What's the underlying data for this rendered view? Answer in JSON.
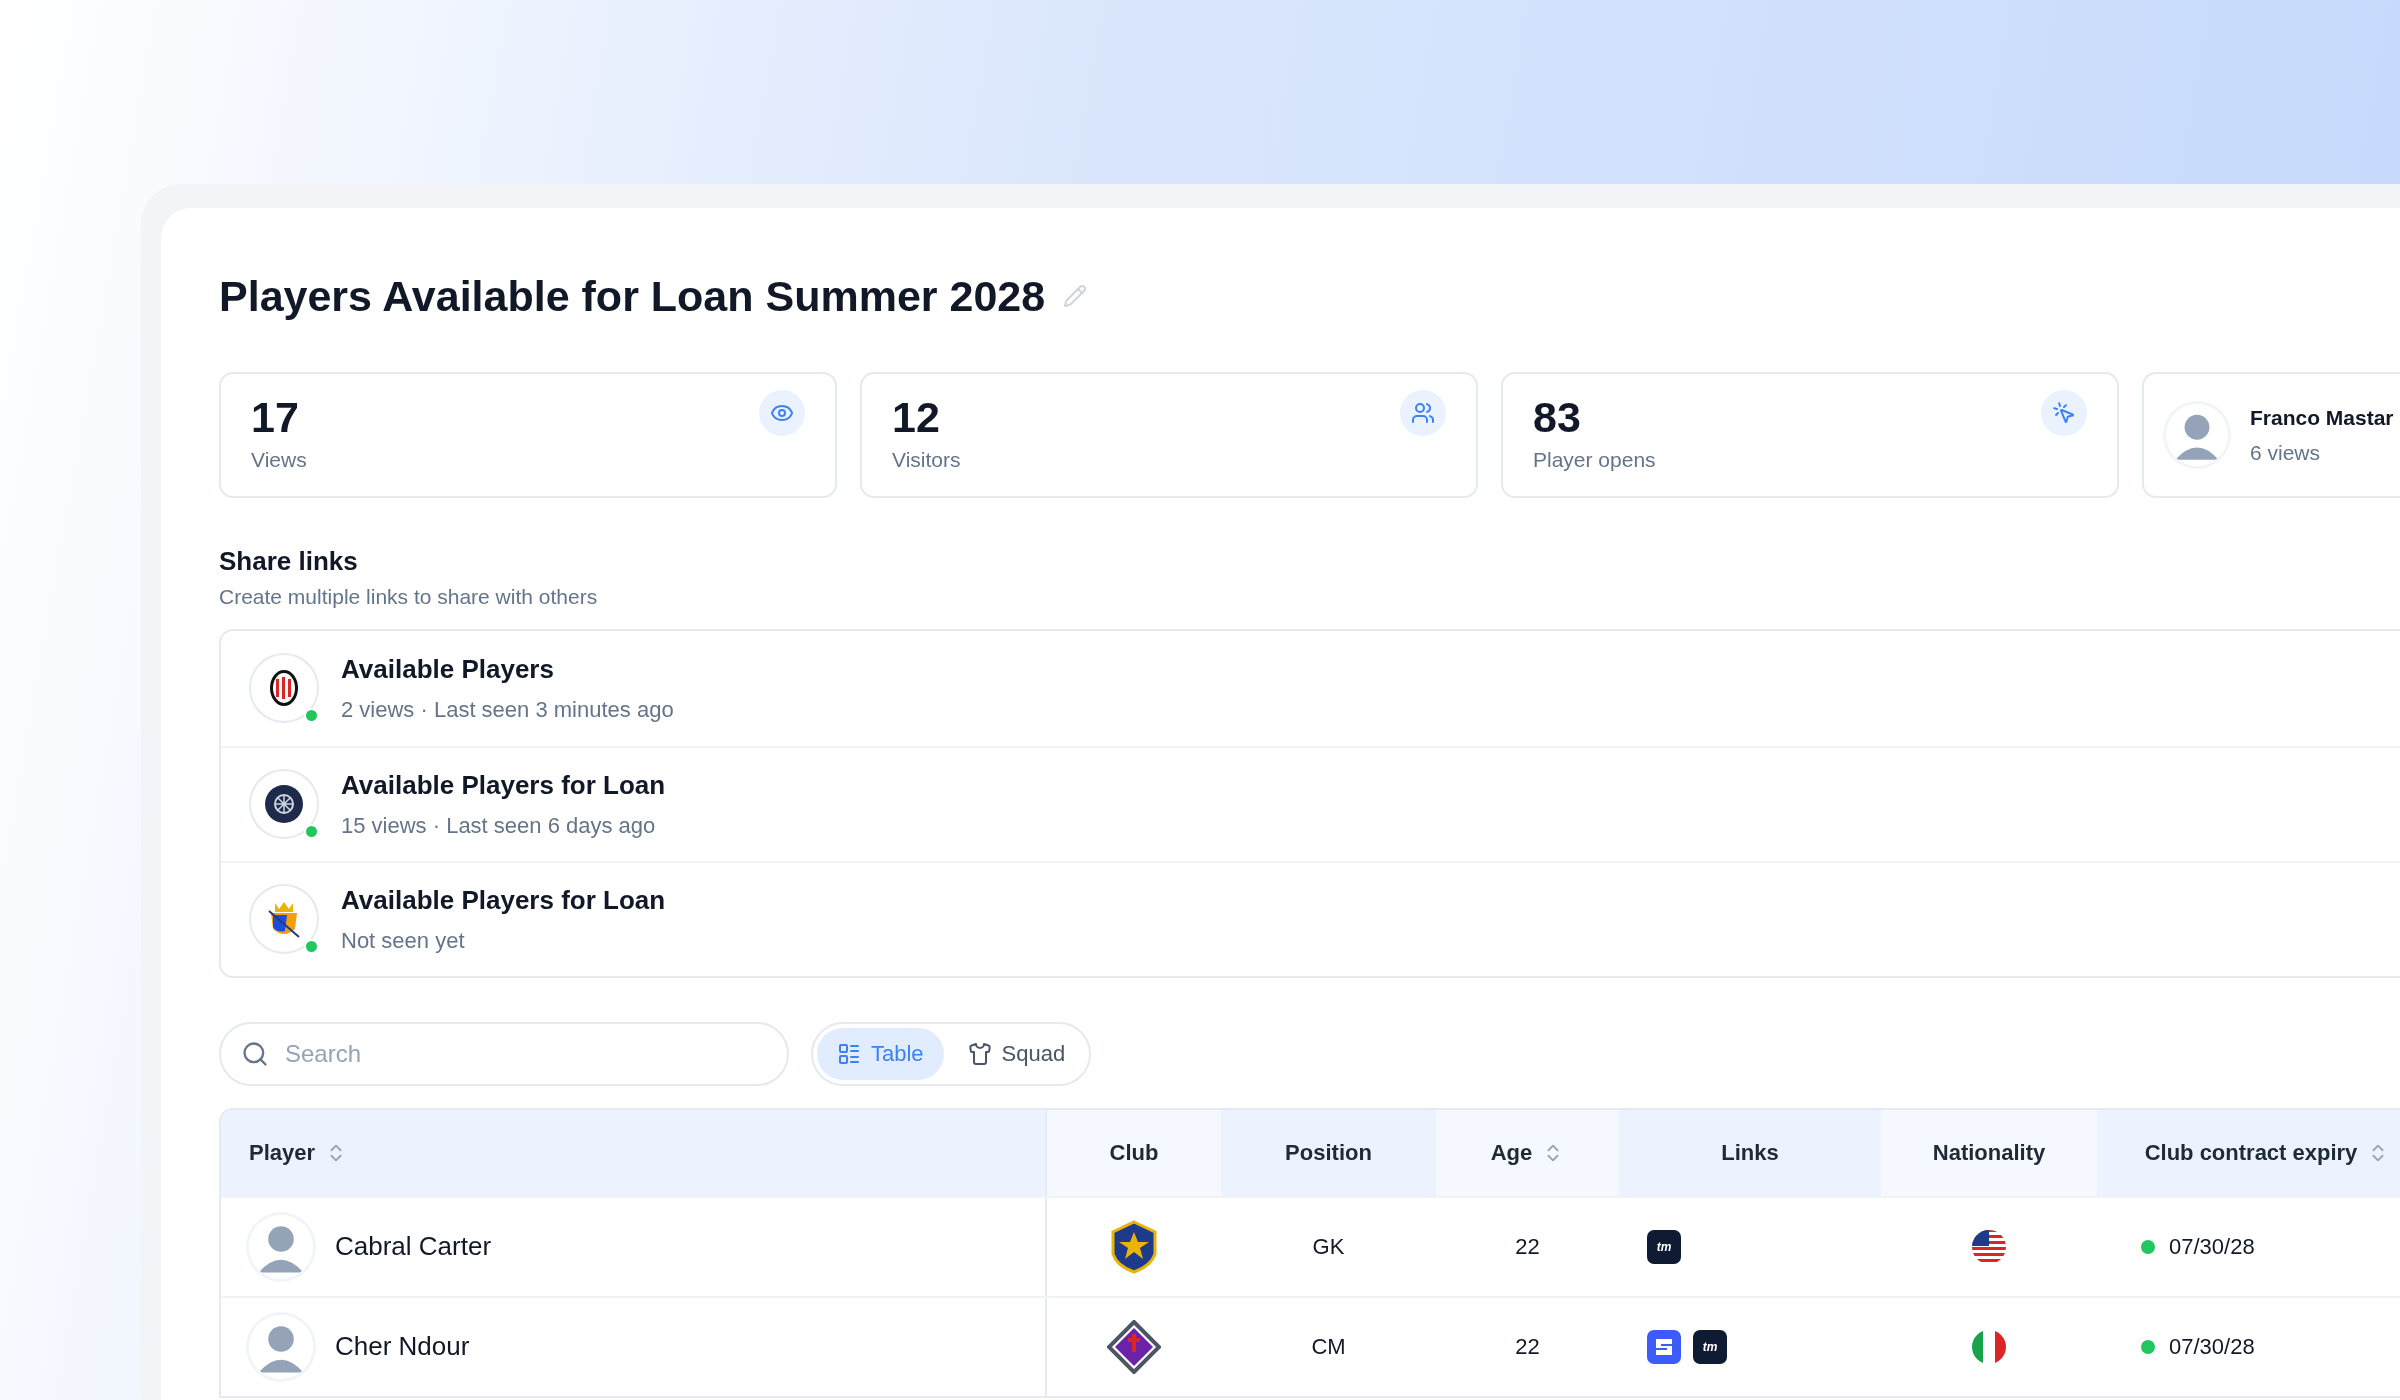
{
  "title": "Players Available for Loan Summer 2028",
  "stats": [
    {
      "kind": "views",
      "value": "17",
      "label": "Views"
    },
    {
      "kind": "visitors",
      "value": "12",
      "label": "Visitors"
    },
    {
      "kind": "opens",
      "value": "83",
      "label": "Player opens"
    }
  ],
  "top_viewer": {
    "name": "Franco Mastar",
    "views": "6 views"
  },
  "share_links": {
    "title": "Share links",
    "subtitle": "Create multiple links to share with others",
    "items": [
      {
        "crest": {
          "kind": "stripes"
        },
        "title": "Available Players",
        "meta": "2 views · Last seen 3 minutes ago",
        "color": "#22c55e"
      },
      {
        "crest": {
          "kind": "navy"
        },
        "title": "Available Players for Loan",
        "meta": "15 views · Last seen 6 days ago",
        "color": "#22c55e"
      },
      {
        "crest": {
          "kind": "crown"
        },
        "title": "Available Players for Loan",
        "meta": "Not seen yet",
        "color": "#22c55e"
      }
    ]
  },
  "search": {
    "placeholder": "Search"
  },
  "views": [
    {
      "kind": "table",
      "label": "Table",
      "selected": true
    },
    {
      "kind": "squad",
      "label": "Squad",
      "selected": false
    }
  ],
  "table": {
    "columns": [
      {
        "label": "Player",
        "sortable": true
      },
      {
        "label": "Club",
        "sortable": false
      },
      {
        "label": "Position",
        "sortable": false
      },
      {
        "label": "Age",
        "sortable": true
      },
      {
        "label": "Links",
        "sortable": false
      },
      {
        "label": "Nationality",
        "sortable": false
      },
      {
        "label": "Club contract expiry",
        "sortable": true
      }
    ],
    "rows": [
      {
        "name": "Cabral Carter",
        "club": {
          "kind": "star"
        },
        "position": "GK",
        "age": "22",
        "links": [
          {
            "kind": "tm",
            "label": "tm"
          }
        ],
        "nationality": {
          "kind": "us"
        },
        "contract": "07/30/28",
        "color": "#22c55e"
      },
      {
        "name": "Cher Ndour",
        "club": {
          "kind": "diamond"
        },
        "position": "CM",
        "age": "22",
        "links": [
          {
            "kind": "s"
          },
          {
            "kind": "tm",
            "label": "tm"
          }
        ],
        "nationality": {
          "kind": "it"
        },
        "contract": "07/30/28",
        "color": "#22c55e"
      }
    ]
  }
}
